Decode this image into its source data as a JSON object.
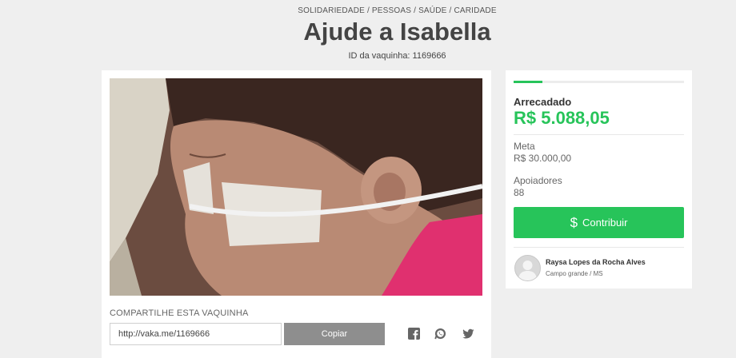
{
  "header": {
    "breadcrumb": "SOLIDARIEDADE / PESSOAS / SAÚDE / CARIDADE",
    "title": "Ajude a Isabella",
    "campaign_id": "ID da vaquinha: 1169666"
  },
  "share": {
    "label": "COMPARTILHE ESTA VAQUINHA",
    "url": "http://vaka.me/1169666",
    "copy_label": "Copiar",
    "icons": [
      "facebook-icon",
      "whatsapp-icon",
      "twitter-icon"
    ]
  },
  "stats": {
    "progress_fraction": 0.17,
    "raised_label": "Arrecadado",
    "raised_value": "R$ 5.088,05",
    "goal_label": "Meta",
    "goal_value": "R$ 30.000,00",
    "backers_label": "Apoiadores",
    "backers_value": "88",
    "contribute_label": "Contribuir"
  },
  "creator": {
    "name": "Raysa Lopes da Rocha Alves",
    "location": "Campo grande / MS"
  },
  "colors": {
    "accent": "#27c45a",
    "copy_button": "#8e8e8e",
    "background": "#efefef"
  }
}
